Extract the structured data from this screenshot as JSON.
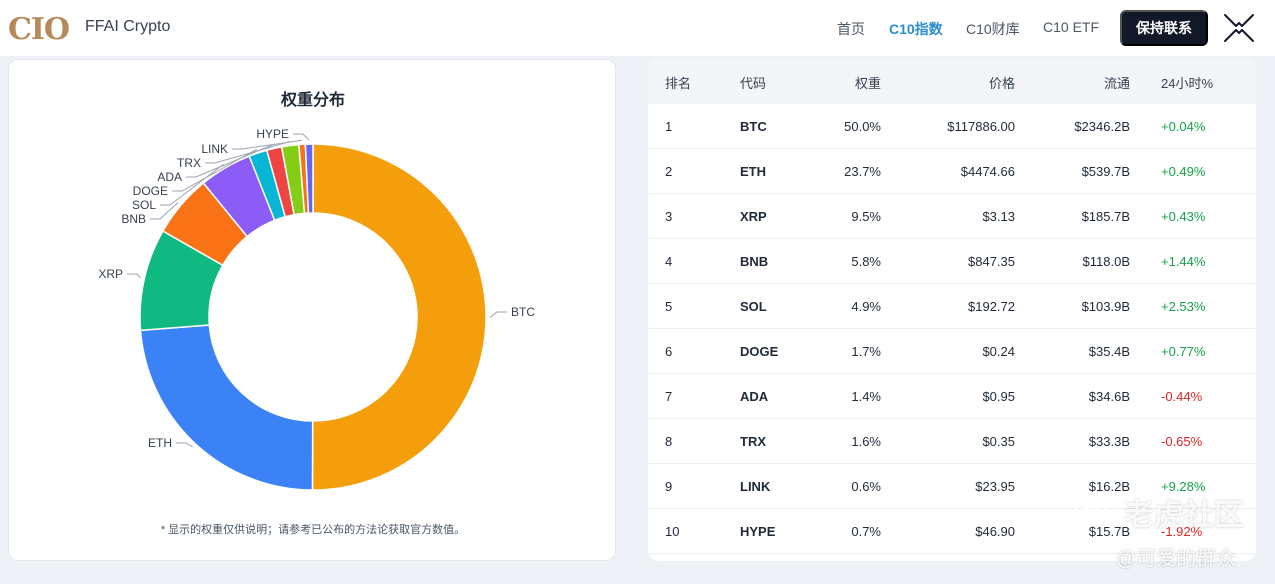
{
  "header": {
    "logo_text": "CIO",
    "brand": "FFAI Crypto",
    "nav": [
      {
        "label": "首页",
        "active": false
      },
      {
        "label": "C10指数",
        "active": true
      },
      {
        "label": "C10财库",
        "active": false
      },
      {
        "label": "C10 ETF",
        "active": false
      }
    ],
    "cta_label": "保持联系",
    "menu_icon": "close-x-icon"
  },
  "chart_panel": {
    "title": "权重分布",
    "note": "* 显示的权重仅供说明；请参考已公布的方法论获取官方数值。"
  },
  "chart_data": {
    "type": "pie",
    "title": "权重分布",
    "donut": true,
    "slices": [
      {
        "label": "BTC",
        "value": 50.0,
        "color": "#f59e0b"
      },
      {
        "label": "ETH",
        "value": 23.7,
        "color": "#3b82f6"
      },
      {
        "label": "XRP",
        "value": 9.5,
        "color": "#10b981"
      },
      {
        "label": "BNB",
        "value": 5.8,
        "color": "#f97316"
      },
      {
        "label": "SOL",
        "value": 4.9,
        "color": "#8b5cf6"
      },
      {
        "label": "DOGE",
        "value": 1.7,
        "color": "#06b6d4"
      },
      {
        "label": "ADA",
        "value": 1.4,
        "color": "#ef4444"
      },
      {
        "label": "TRX",
        "value": 1.6,
        "color": "#84cc16"
      },
      {
        "label": "LINK",
        "value": 0.6,
        "color": "#f97316"
      },
      {
        "label": "HYPE",
        "value": 0.7,
        "color": "#6366f1"
      }
    ]
  },
  "table": {
    "columns": [
      "排名",
      "代码",
      "权重",
      "价格",
      "流通",
      "24小时%"
    ],
    "rows": [
      {
        "rank": "1",
        "code": "BTC",
        "weight": "50.0%",
        "price": "$117886.00",
        "supply": "$2346.2B",
        "change": "+0.04%",
        "dir": "pos"
      },
      {
        "rank": "2",
        "code": "ETH",
        "weight": "23.7%",
        "price": "$4474.66",
        "supply": "$539.7B",
        "change": "+0.49%",
        "dir": "pos"
      },
      {
        "rank": "3",
        "code": "XRP",
        "weight": "9.5%",
        "price": "$3.13",
        "supply": "$185.7B",
        "change": "+0.43%",
        "dir": "pos"
      },
      {
        "rank": "4",
        "code": "BNB",
        "weight": "5.8%",
        "price": "$847.35",
        "supply": "$118.0B",
        "change": "+1.44%",
        "dir": "pos"
      },
      {
        "rank": "5",
        "code": "SOL",
        "weight": "4.9%",
        "price": "$192.72",
        "supply": "$103.9B",
        "change": "+2.53%",
        "dir": "pos"
      },
      {
        "rank": "6",
        "code": "DOGE",
        "weight": "1.7%",
        "price": "$0.24",
        "supply": "$35.4B",
        "change": "+0.77%",
        "dir": "pos"
      },
      {
        "rank": "7",
        "code": "ADA",
        "weight": "1.4%",
        "price": "$0.95",
        "supply": "$34.6B",
        "change": "-0.44%",
        "dir": "neg"
      },
      {
        "rank": "8",
        "code": "TRX",
        "weight": "1.6%",
        "price": "$0.35",
        "supply": "$33.3B",
        "change": "-0.65%",
        "dir": "neg"
      },
      {
        "rank": "9",
        "code": "LINK",
        "weight": "0.6%",
        "price": "$23.95",
        "supply": "$16.2B",
        "change": "+9.28%",
        "dir": "pos"
      },
      {
        "rank": "10",
        "code": "HYPE",
        "weight": "0.7%",
        "price": "$46.90",
        "supply": "$15.7B",
        "change": "-1.92%",
        "dir": "neg"
      }
    ]
  },
  "watermark": {
    "line1": "老虎社区",
    "line2": "@可爱的群众",
    "icon": "tiger-logo-icon"
  },
  "colors": {
    "positive": "#16a34a",
    "negative": "#dc2626",
    "accent_nav": "#2b8ecf",
    "cta_bg": "#111827"
  }
}
